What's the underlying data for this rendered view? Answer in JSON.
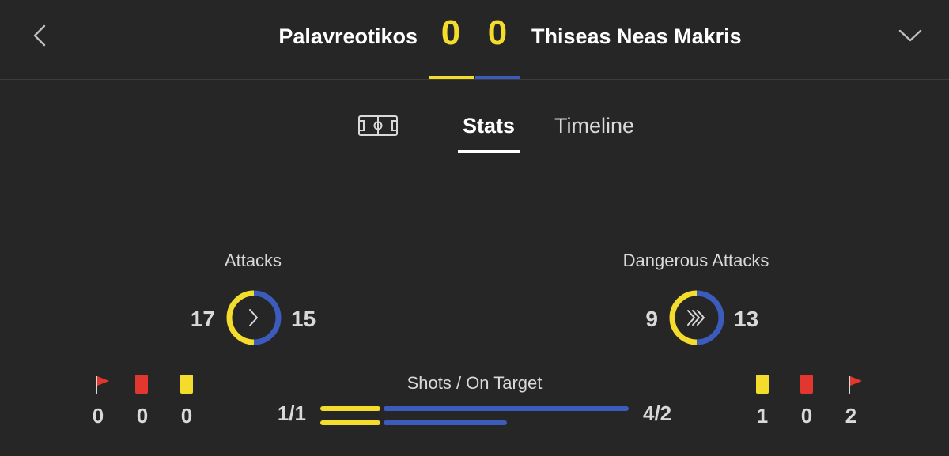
{
  "colors": {
    "home": "#f3dc2c",
    "away": "#3c5cbd",
    "card_red": "#e2372e",
    "card_yellow": "#f3dc2c"
  },
  "header": {
    "home_team": "Palavreotikos",
    "away_team": "Thiseas Neas Makris",
    "home_score": "0",
    "away_score": "0",
    "back_icon": "chevron-left-icon",
    "menu_icon": "chevron-down-icon"
  },
  "tabs": {
    "field_icon": "pitch-icon",
    "items": [
      {
        "label": "Stats",
        "active": true
      },
      {
        "label": "Timeline",
        "active": false
      }
    ]
  },
  "stats": {
    "attacks": {
      "label": "Attacks",
      "home": "17",
      "away": "15",
      "icon": "chevron-right-icon"
    },
    "dangerous_attacks": {
      "label": "Dangerous Attacks",
      "home": "9",
      "away": "13",
      "icon": "triple-chevron-right-icon"
    },
    "home_events": {
      "corners": "0",
      "red_cards": "0",
      "yellow_cards": "0"
    },
    "away_events": {
      "yellow_cards": "1",
      "red_cards": "0",
      "corners": "2"
    },
    "shots": {
      "label": "Shots / On Target",
      "home_text": "1/1",
      "away_text": "4/2",
      "home_shots": 1,
      "home_on_target": 1,
      "away_shots": 4,
      "away_on_target": 2
    }
  }
}
